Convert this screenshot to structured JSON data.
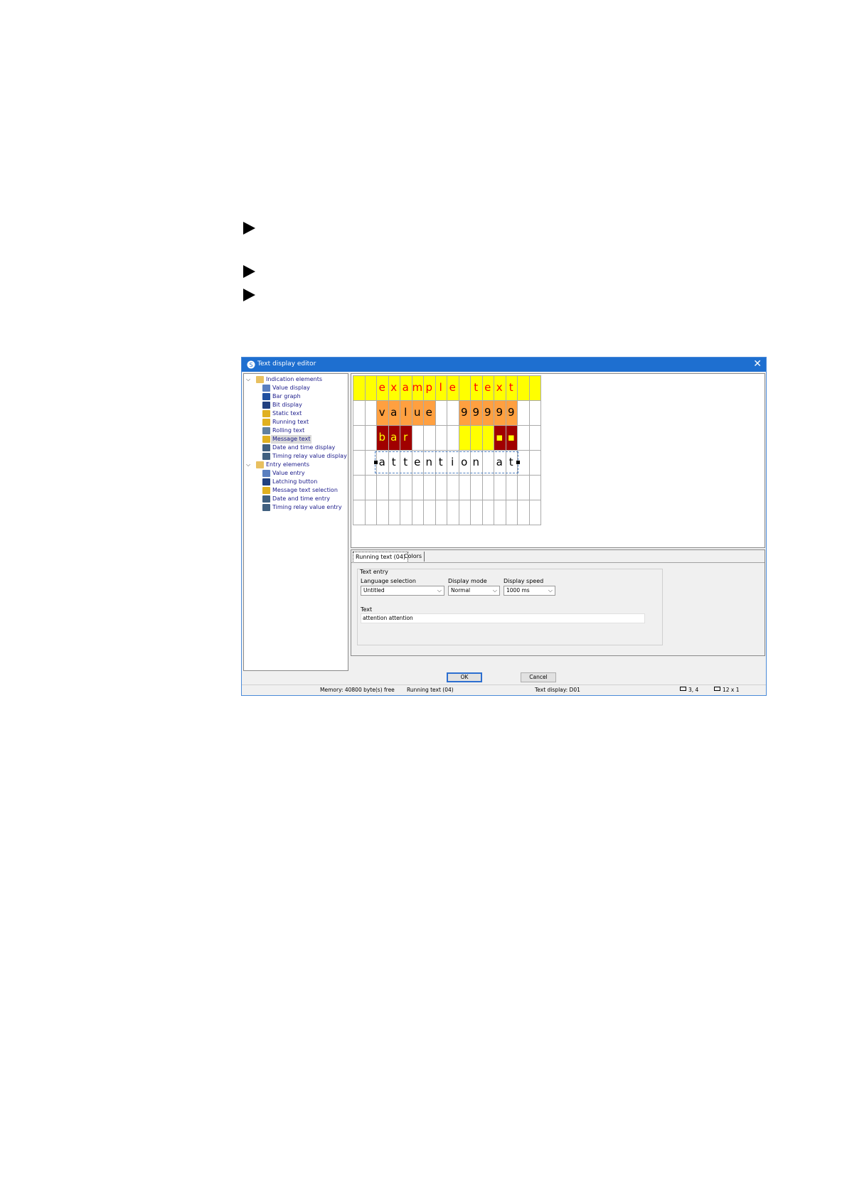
{
  "window": {
    "title": "Text display editor",
    "close_glyph": "✕"
  },
  "tree": {
    "groups": [
      {
        "label": "Indication elements",
        "items": [
          "Value display",
          "Bar graph",
          "Bit display",
          "Static text",
          "Running text",
          "Rolling text",
          "Message text",
          "Date and time display",
          "Timing relay value display"
        ]
      },
      {
        "label": "Entry elements",
        "items": [
          "Value entry",
          "Latching button",
          "Message text selection",
          "Date and time entry",
          "Timing relay value entry"
        ]
      }
    ],
    "selected": "Message text"
  },
  "display": {
    "row1": [
      "e",
      "x",
      "a",
      "m",
      "p",
      "l",
      "e",
      " ",
      "t",
      "e",
      "x",
      "t"
    ],
    "row2a": [
      "v",
      "a",
      "l",
      "u",
      "e"
    ],
    "row2b": [
      "9",
      "9",
      "9",
      "9",
      "9"
    ],
    "row3": [
      "b",
      "a",
      "r"
    ],
    "row3_marks": [
      "▪",
      "▪"
    ],
    "row4": [
      "a",
      "t",
      "t",
      "e",
      "n",
      "t",
      "i",
      "o",
      "n",
      " ",
      "a",
      "t"
    ],
    "colors": {
      "yellow": "#ffff00",
      "orange": "#ffa040",
      "darkred": "#a00000",
      "red": "#ff0000"
    }
  },
  "tabs": [
    {
      "label": "Running text (04)",
      "active": true
    },
    {
      "label": "Colors",
      "active": false
    }
  ],
  "text_entry": {
    "group_label": "Text entry",
    "language_label": "Language selection",
    "language_value": "Untitled",
    "display_mode_label": "Display mode",
    "display_mode_value": "Normal",
    "display_speed_label": "Display speed",
    "display_speed_value": "1000 ms",
    "text_label": "Text",
    "text_value": "attention attention"
  },
  "buttons": {
    "ok": "OK",
    "cancel": "Cancel"
  },
  "status": {
    "memory": "Memory: 40800 byte(s) free",
    "element": "Running text (04)",
    "display": "Text display: D01",
    "position": "3,  4",
    "size": "12 x  1"
  }
}
